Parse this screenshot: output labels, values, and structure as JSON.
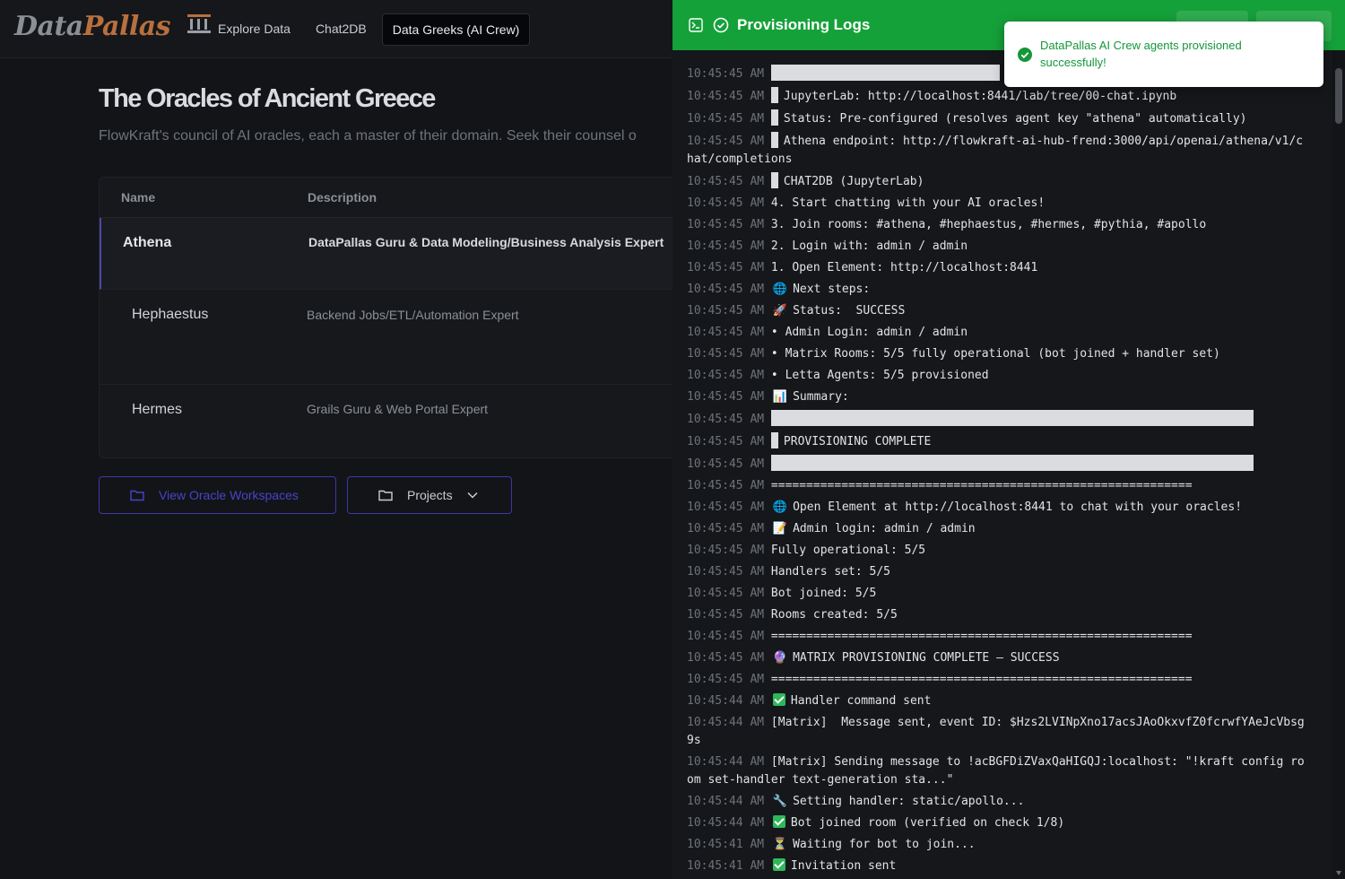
{
  "app": {
    "logo_part1": "Data",
    "logo_part2": "Pallas",
    "nav": [
      "Explore Data",
      "Chat2DB",
      "Data Greeks (AI Crew)"
    ],
    "page_title": "The Oracles of Ancient Greece",
    "page_subtitle": "FlowKraft's council of AI oracles, each a master of their domain. Seek their counsel o",
    "table": {
      "headers": [
        "Name",
        "Description"
      ],
      "rows": [
        {
          "name": "Athena",
          "description": "DataPallas Guru & Data Modeling/Business Analysis Expert"
        },
        {
          "name": "Hephaestus",
          "description": "Backend Jobs/ETL/Automation Expert"
        },
        {
          "name": "Hermes",
          "description": "Grails Guru & Web Portal Expert"
        }
      ]
    },
    "buttons": {
      "workspaces": "View Oracle Workspaces",
      "projects": "Projects"
    }
  },
  "panel": {
    "title": "Provisioning Logs",
    "accent": "#15a13a",
    "log": [
      {
        "ts": "10:45:45 AM",
        "text": "",
        "kind": "bar",
        "w": 255
      },
      {
        "ts": "10:45:45 AM",
        "text": "JupyterLab: http://localhost:8441/lab/tree/00-chat.ipynb",
        "kind": "small"
      },
      {
        "ts": "10:45:45 AM",
        "text": "Status: Pre-configured (resolves agent key \"athena\" automatically)",
        "kind": "small"
      },
      {
        "ts": "10:45:45 AM",
        "text": "Athena endpoint: http://flowkraft-ai-hub-frend:3000/api/openai/athena/v1/chat/completions",
        "kind": "small"
      },
      {
        "ts": "10:45:45 AM",
        "text": "CHAT2DB (JupyterLab)",
        "kind": "small"
      },
      {
        "ts": "10:45:45 AM",
        "text": "4. Start chatting with your AI oracles!"
      },
      {
        "ts": "10:45:45 AM",
        "text": "3. Join rooms: #athena, #hephaestus, #hermes, #pythia, #apollo"
      },
      {
        "ts": "10:45:45 AM",
        "text": "2. Login with: admin / admin"
      },
      {
        "ts": "10:45:45 AM",
        "text": "1. Open Element: http://localhost:8441"
      },
      {
        "ts": "10:45:45 AM",
        "text": "Next steps:",
        "icon": "🌐"
      },
      {
        "ts": "10:45:45 AM",
        "text": "Status:  SUCCESS",
        "icon": "🚀",
        "check_mid": true
      },
      {
        "ts": "10:45:45 AM",
        "text": "• Admin Login: admin / admin"
      },
      {
        "ts": "10:45:45 AM",
        "text": "• Matrix Rooms: 5/5 fully operational (bot joined + handler set)"
      },
      {
        "ts": "10:45:45 AM",
        "text": "• Letta Agents: 5/5 provisioned"
      },
      {
        "ts": "10:45:45 AM",
        "text": "Summary:",
        "icon": "📊"
      },
      {
        "ts": "10:45:45 AM",
        "text": "",
        "kind": "bar",
        "w": 538
      },
      {
        "ts": "10:45:45 AM",
        "text": "PROVISIONING COMPLETE",
        "kind": "small"
      },
      {
        "ts": "10:45:45 AM",
        "text": "",
        "kind": "bar",
        "w": 538
      },
      {
        "ts": "10:45:45 AM",
        "text": "============================================================"
      },
      {
        "ts": "10:45:45 AM",
        "text": "Open Element at http://localhost:8441 to chat with your oracles!",
        "icon": "🌐"
      },
      {
        "ts": "10:45:45 AM",
        "text": "Admin login: admin / admin",
        "icon": "📝"
      },
      {
        "ts": "10:45:45 AM",
        "text": "Fully operational: 5/5"
      },
      {
        "ts": "10:45:45 AM",
        "text": "Handlers set: 5/5"
      },
      {
        "ts": "10:45:45 AM",
        "text": "Bot joined: 5/5"
      },
      {
        "ts": "10:45:45 AM",
        "text": "Rooms created: 5/5"
      },
      {
        "ts": "10:45:45 AM",
        "text": "============================================================"
      },
      {
        "ts": "10:45:45 AM",
        "text": "MATRIX PROVISIONING COMPLETE — SUCCESS",
        "icon": "🔮"
      },
      {
        "ts": "10:45:45 AM",
        "text": "============================================================"
      },
      {
        "ts": "10:45:44 AM",
        "text": "Handler command sent",
        "check": true
      },
      {
        "ts": "10:45:44 AM",
        "text": "[Matrix]  Message sent, event ID: $Hzs2LVINpXno17acsJAoOkxvfZ0fcrwfYAeJcVbsg9s",
        "check_after_prefix": "[Matrix]"
      },
      {
        "ts": "10:45:44 AM",
        "text": "[Matrix] Sending message to !acBGFDiZVaxQaHIGQJ:localhost: \"!kraft config room set-handler text-generation sta...\""
      },
      {
        "ts": "10:45:44 AM",
        "text": "Setting handler: static/apollo...",
        "icon": "🔧"
      },
      {
        "ts": "10:45:44 AM",
        "text": "Bot joined room (verified on check 1/8)",
        "check": true
      },
      {
        "ts": "10:45:41 AM",
        "text": "Waiting for bot to join...",
        "icon": "⏳"
      },
      {
        "ts": "10:45:41 AM",
        "text": "Invitation sent",
        "check": true
      }
    ]
  },
  "toast": {
    "message": "DataPallas AI Crew agents provisioned successfully!"
  }
}
